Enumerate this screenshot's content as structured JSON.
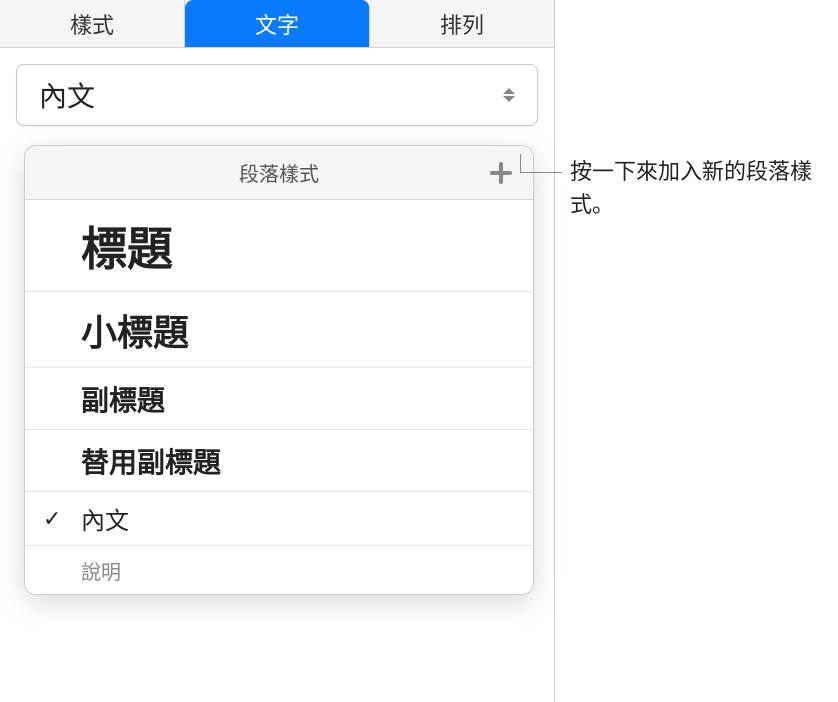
{
  "tabs": {
    "style": "樣式",
    "text": "文字",
    "arrange": "排列"
  },
  "dropdown": {
    "selected": "內文"
  },
  "popover": {
    "title": "段落樣式"
  },
  "styles": {
    "title": "標題",
    "subtitle": "小標題",
    "heading": "副標題",
    "altHeading": "替用副標題",
    "body": "內文",
    "caption": "說明"
  },
  "callout": {
    "text": "按一下來加入新的段落樣式。"
  }
}
